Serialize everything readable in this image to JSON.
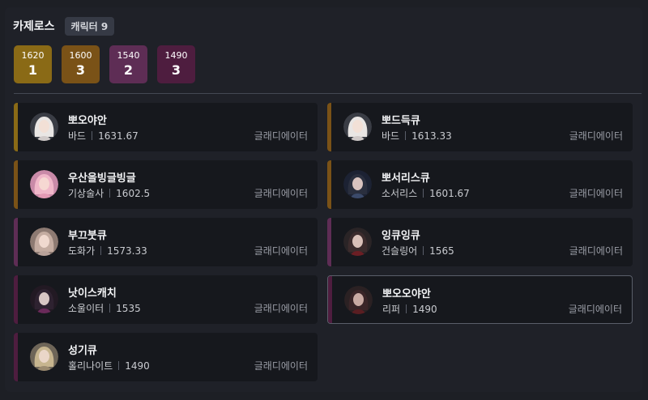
{
  "server": {
    "name": "카제로스",
    "badge": "캐릭터 9"
  },
  "tiers": [
    {
      "level": "1620",
      "count": "1",
      "color": "#8a6a16"
    },
    {
      "level": "1600",
      "count": "3",
      "color": "#7a5217"
    },
    {
      "level": "1540",
      "count": "2",
      "color": "#5e2d55"
    },
    {
      "level": "1490",
      "count": "3",
      "color": "#4e1d3f"
    }
  ],
  "characters": [
    {
      "name": "뽀오야안",
      "class": "바드",
      "level": "1631.67",
      "guild": "글래디에이터",
      "bar": "#8a6a16",
      "avatar_icon": "bard-portrait-icon"
    },
    {
      "name": "뽀드득큐",
      "class": "바드",
      "level": "1613.33",
      "guild": "글래디에이터",
      "bar": "#7a5217",
      "avatar_icon": "bard-portrait-icon"
    },
    {
      "name": "우산을빙글빙글",
      "class": "기상술사",
      "level": "1602.5",
      "guild": "글래디에이터",
      "bar": "#7a5217",
      "avatar_icon": "aeromancer-portrait-icon"
    },
    {
      "name": "뽀서리스큐",
      "class": "소서리스",
      "level": "1601.67",
      "guild": "글래디에이터",
      "bar": "#7a5217",
      "avatar_icon": "sorceress-portrait-icon"
    },
    {
      "name": "부끄붓큐",
      "class": "도화가",
      "level": "1573.33",
      "guild": "글래디에이터",
      "bar": "#5e2d55",
      "avatar_icon": "artist-portrait-icon"
    },
    {
      "name": "잉큐잉큐",
      "class": "건슬링어",
      "level": "1565",
      "guild": "글래디에이터",
      "bar": "#5e2d55",
      "avatar_icon": "gunslinger-portrait-icon"
    },
    {
      "name": "낫이스캐치",
      "class": "소울이터",
      "level": "1535",
      "guild": "글래디에이터",
      "bar": "#4e1d3f",
      "avatar_icon": "souleater-portrait-icon"
    },
    {
      "name": "뽀오오야안",
      "class": "리퍼",
      "level": "1490",
      "guild": "글래디에이터",
      "bar": "#4e1d3f",
      "avatar_icon": "reaper-portrait-icon",
      "selected": true
    },
    {
      "name": "성기큐",
      "class": "홀리나이트",
      "level": "1490",
      "guild": "글래디에이터",
      "bar": "#4e1d3f",
      "avatar_icon": "paladin-portrait-icon"
    }
  ]
}
